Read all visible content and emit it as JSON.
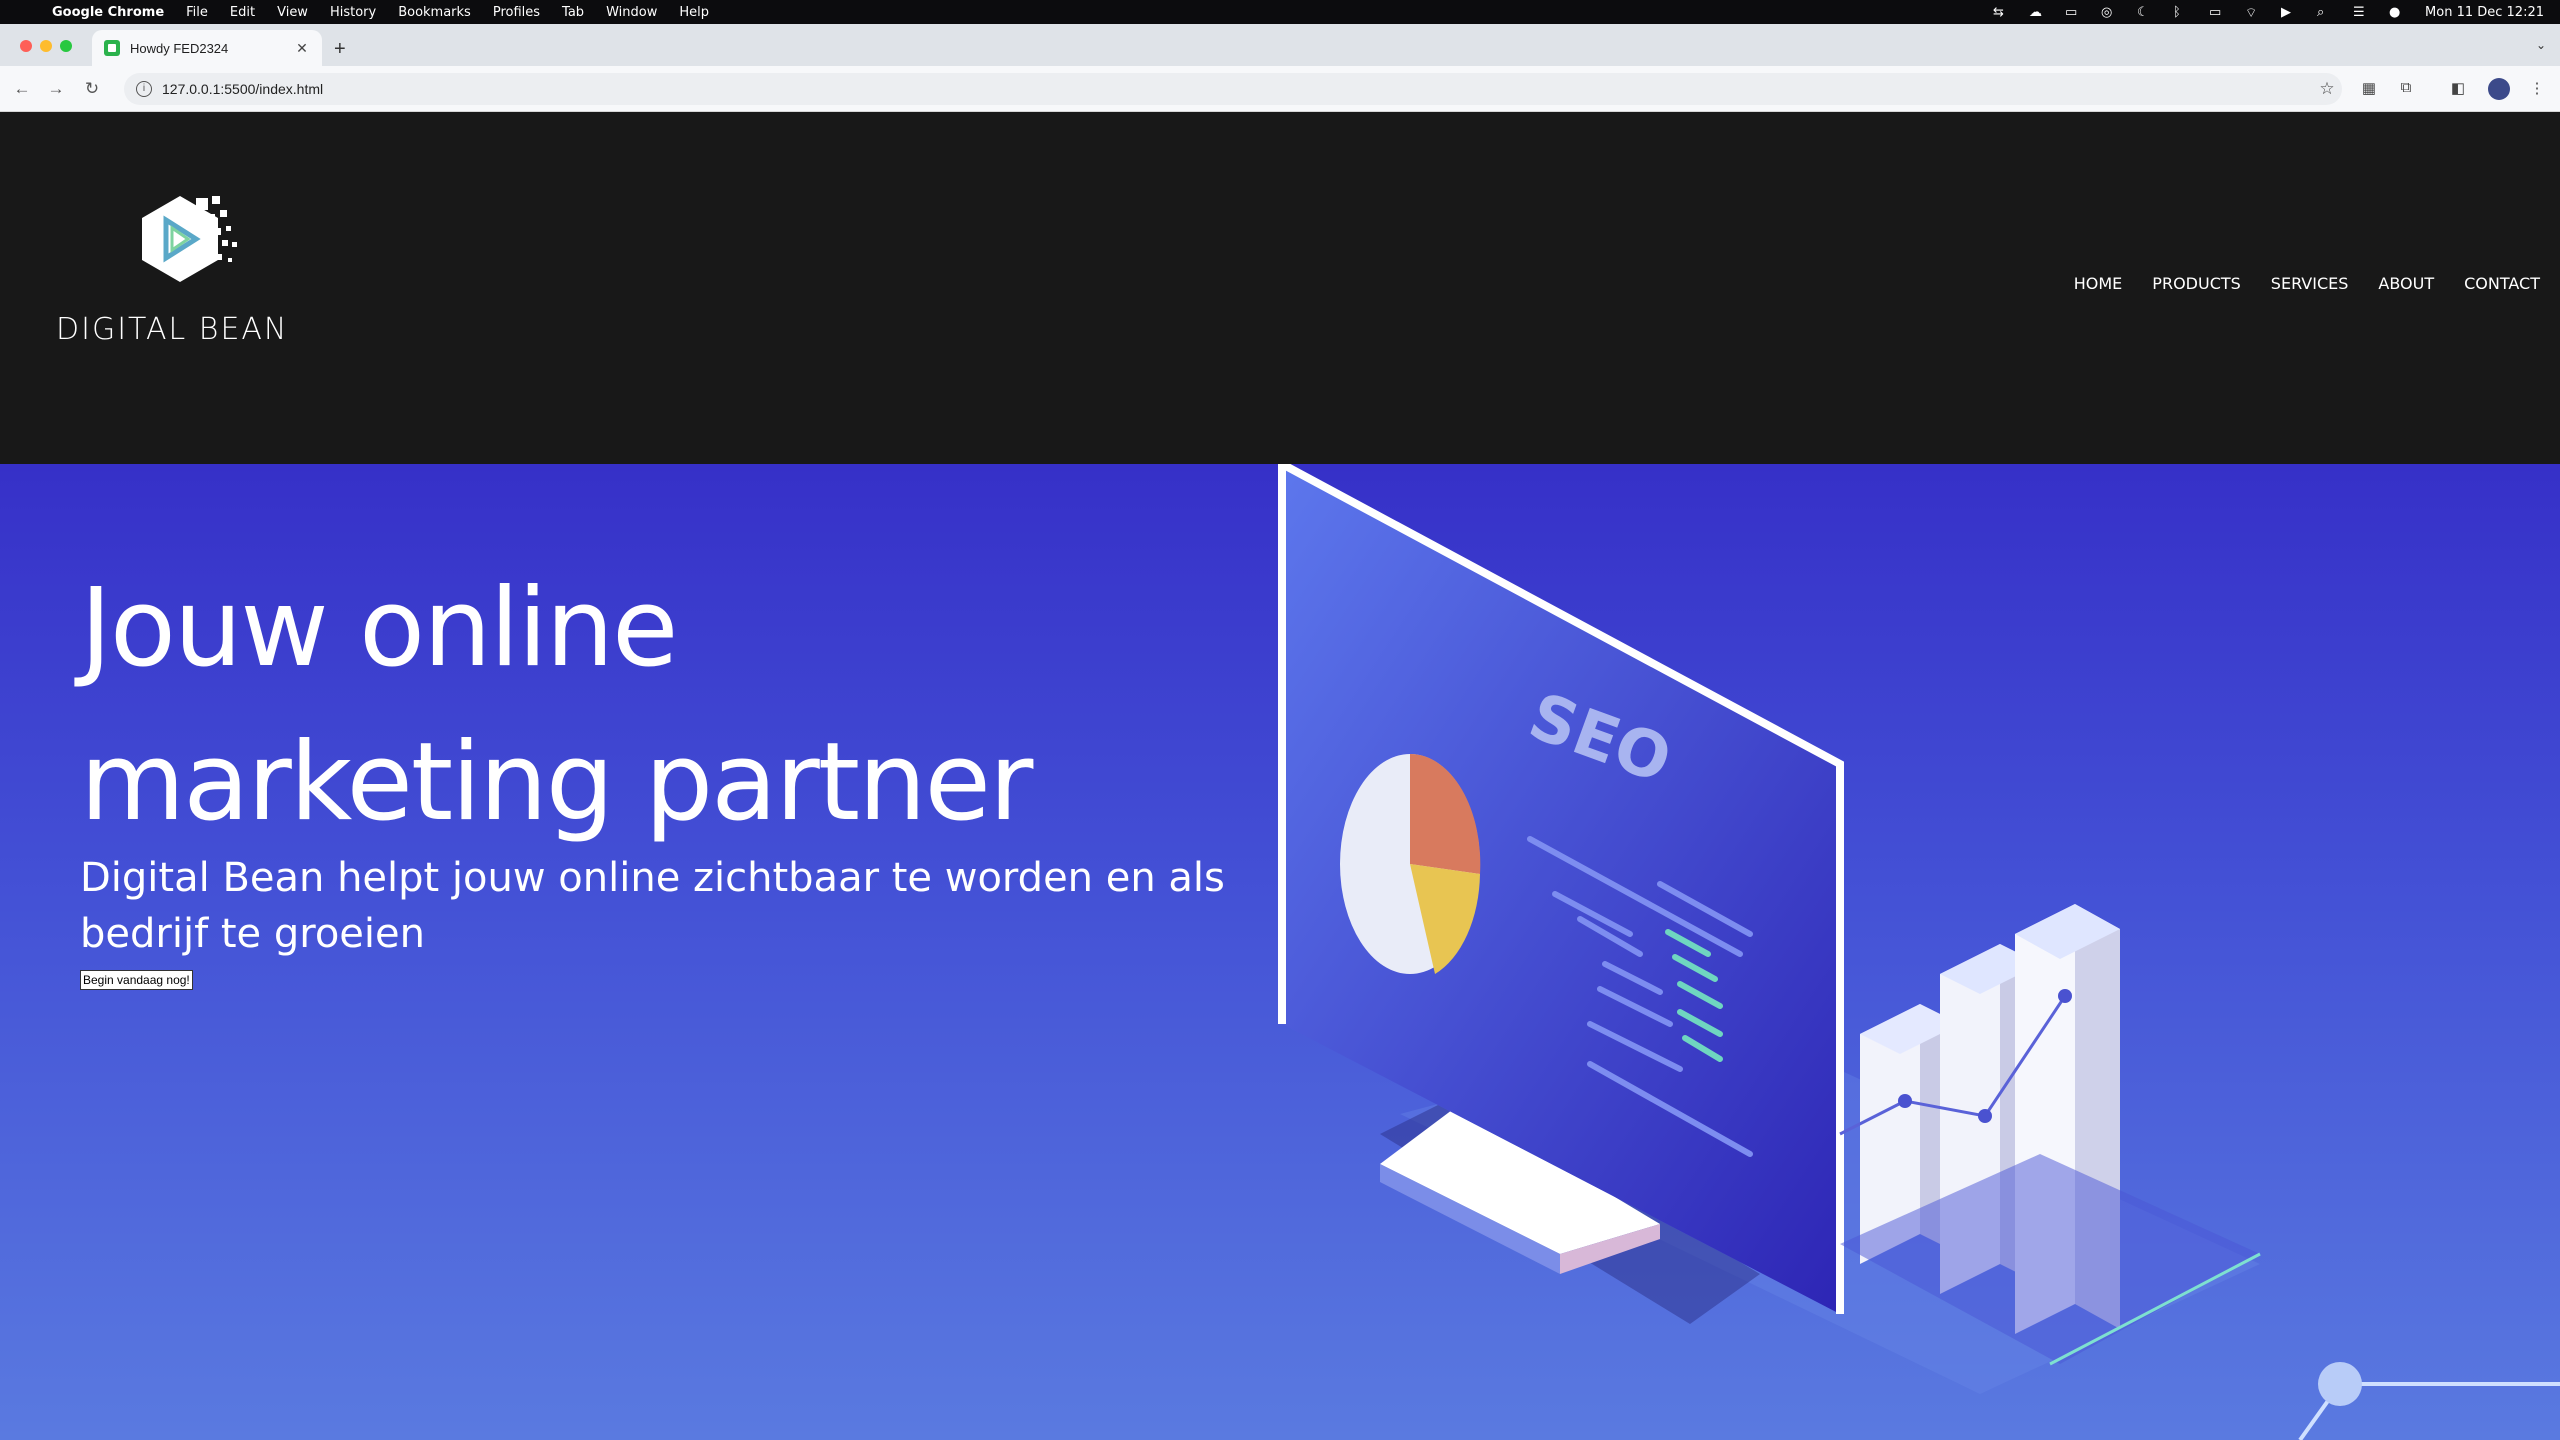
{
  "macos_menubar": {
    "app_name": "Google Chrome",
    "items": [
      "File",
      "Edit",
      "View",
      "History",
      "Bookmarks",
      "Profiles",
      "Tab",
      "Window",
      "Help"
    ],
    "clock": "Mon 11 Dec  12:21"
  },
  "browser": {
    "tab_title": "Howdy FED2324",
    "url": "127.0.0.1:5500/index.html"
  },
  "site": {
    "logo_text": "DIGITAL BEAN",
    "nav": [
      "HOME",
      "PRODUCTS",
      "SERVICES",
      "ABOUT",
      "CONTACT"
    ],
    "hero": {
      "title": "Jouw online marketing partner",
      "subtitle": "Digital Bean helpt jouw online zichtbaar te worden en als bedrijf te groeien",
      "cta_label": "Begin vandaag nog!",
      "illustration_text": "SEO"
    }
  },
  "colors": {
    "header_bg": "#181818",
    "hero_top": "#3630c8",
    "hero_bottom": "#5a7ae0"
  }
}
